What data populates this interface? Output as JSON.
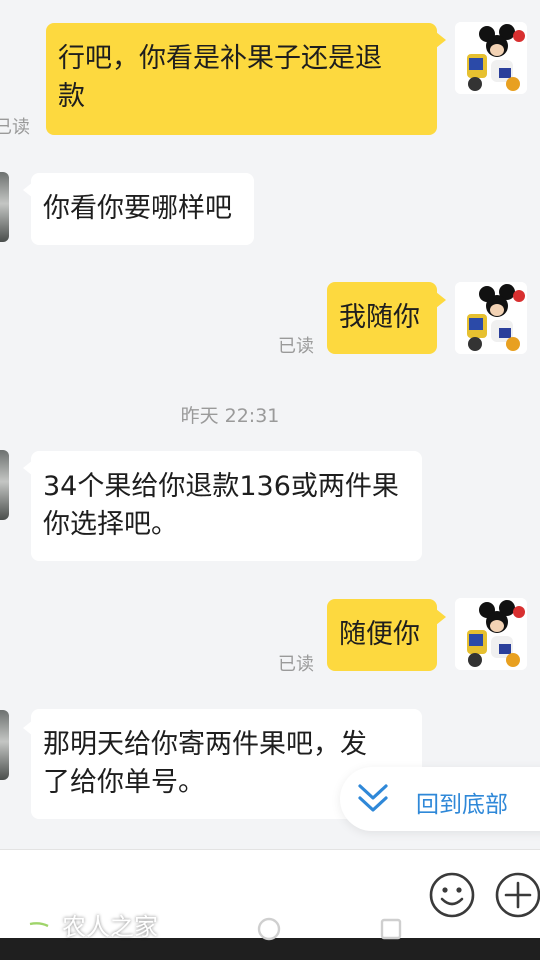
{
  "messages": [
    {
      "id": "m1",
      "side": "out",
      "text_lines": [
        "行吧，你看是补果子还是退",
        "款"
      ],
      "status": "已读"
    },
    {
      "id": "m2",
      "side": "in",
      "text_lines": [
        "你看你要哪样吧"
      ]
    },
    {
      "id": "m3",
      "side": "out",
      "text_lines": [
        "我随你"
      ],
      "status": "已读"
    },
    {
      "id": "m4",
      "side": "in",
      "text_lines": [
        "34个果给你退款136或两件果",
        "你选择吧。"
      ]
    },
    {
      "id": "m5",
      "side": "out",
      "text_lines": [
        "随便你"
      ],
      "status": "已读"
    },
    {
      "id": "m6",
      "side": "in",
      "text_lines": [
        "那明天给你寄两件果吧，发",
        "了给你单号。"
      ]
    }
  ],
  "timestamp": "昨天 22:31",
  "back_to_bottom": {
    "label": "回到底部",
    "icon": "double-chevron-down-icon"
  },
  "input_bar": {
    "emoji_icon": "smiley-icon",
    "plus_icon": "plus-icon"
  },
  "watermark": {
    "text": "农人之家",
    "icon": "watermark-logo-icon"
  },
  "colors": {
    "outgoing_bubble": "#fdd93f",
    "incoming_bubble": "#ffffff",
    "background": "#f3f4f6",
    "link": "#2f88d8",
    "muted_text": "#9a9a9a"
  }
}
